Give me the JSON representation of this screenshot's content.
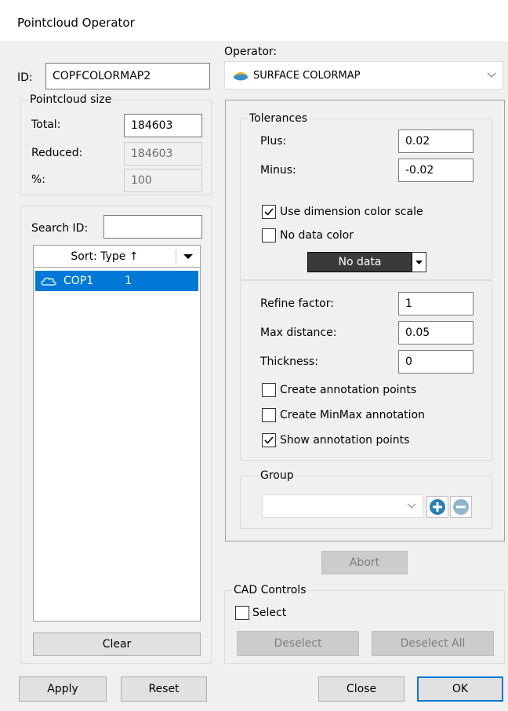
{
  "window": {
    "title": "Pointcloud Operator"
  },
  "left": {
    "id_label": "ID:",
    "id_value": "COPFCOLORMAP2",
    "size_group_title": "Pointcloud size",
    "total_label": "Total:",
    "total_value": "184603",
    "reduced_label": "Reduced:",
    "reduced_value": "184603",
    "percent_label": "%:",
    "percent_value": "100",
    "search_label": "Search ID:",
    "search_value": "",
    "sort_header": "Sort: Type ↑",
    "list_items": [
      {
        "name": "COP1",
        "type": "1",
        "icon": "pointcloud-icon",
        "selected": true
      }
    ],
    "clear_label": "Clear"
  },
  "operator": {
    "label": "Operator:",
    "selected": "SURFACE COLORMAP",
    "icon": "surface-colormap-icon"
  },
  "tolerances": {
    "title": "Tolerances",
    "plus_label": "Plus:",
    "plus_value": "0.02",
    "minus_label": "Minus:",
    "minus_value": "-0.02",
    "use_dimension_scale_label": "Use dimension color scale",
    "use_dimension_scale_checked": true,
    "no_data_color_label": "No data color",
    "no_data_color_checked": false,
    "no_data_swatch_label": "No data",
    "no_data_swatch_color": "#3a3a3a"
  },
  "refine": {
    "refine_factor_label": "Refine factor:",
    "refine_factor_value": "1",
    "max_distance_label": "Max distance:",
    "max_distance_value": "0.05",
    "thickness_label": "Thickness:",
    "thickness_value": "0",
    "create_annotation_points_label": "Create annotation points",
    "create_annotation_points_checked": false,
    "create_minmax_label": "Create MinMax annotation",
    "create_minmax_checked": false,
    "show_annotation_points_label": "Show annotation points",
    "show_annotation_points_checked": true
  },
  "group": {
    "title": "Group",
    "selected": "",
    "add_icon": "plus-circle-icon",
    "remove_icon": "minus-circle-icon"
  },
  "abort_label": "Abort",
  "cad_controls": {
    "title": "CAD Controls",
    "select_label": "Select",
    "select_checked": false,
    "deselect_label": "Deselect",
    "deselect_all_label": "Deselect All"
  },
  "footer": {
    "apply_label": "Apply",
    "reset_label": "Reset",
    "close_label": "Close",
    "ok_label": "OK"
  },
  "colors": {
    "selection": "#0078d7",
    "default_button_border": "#0078d7",
    "cloud_icon": "#47b8d8",
    "add_icon": "#2a7fb4",
    "remove_icon": "#8fb5cc"
  }
}
